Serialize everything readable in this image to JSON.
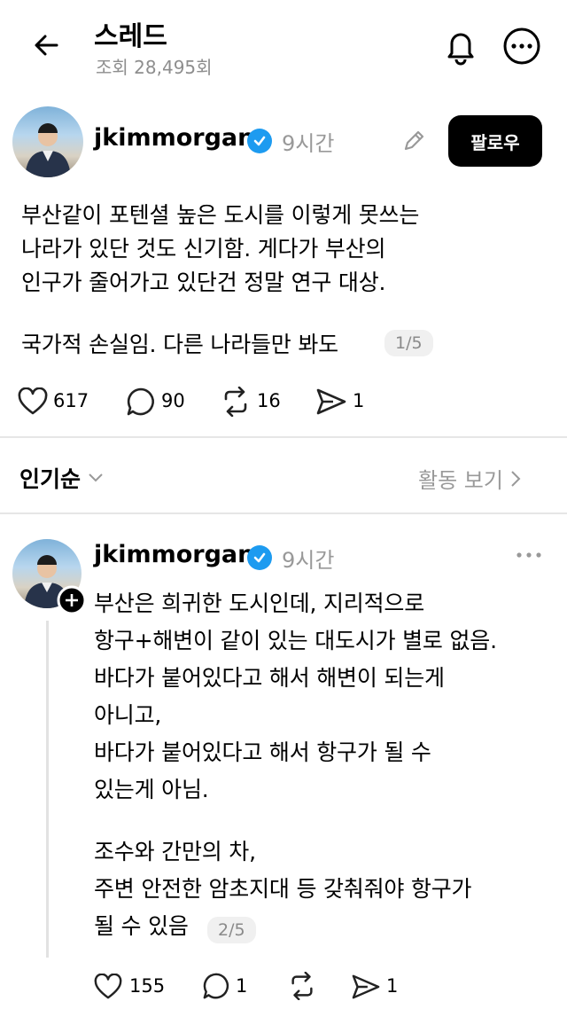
{
  "header": {
    "title": "스레드",
    "views": "조회 28,495회"
  },
  "post": {
    "username": "jkimmorgan",
    "time": "9시간",
    "follow_label": "팔로우",
    "text_lines": [
      "부산같이 포텐셜 높은 도시를 이렇게 못쓰는",
      "나라가 있단 것도 신기함. 게다가 부산의",
      "인구가 줄어가고 있단건 정말 연구 대상."
    ],
    "text_last": "국가적 손실임. 다른 나라들만 봐도",
    "pager": "1/5",
    "likes": "617",
    "comments": "90",
    "reposts": "16",
    "shares": "1"
  },
  "sort": {
    "label": "인기순",
    "activity_label": "활동 보기"
  },
  "reply": {
    "username": "jkimmorgan",
    "time": "9시간",
    "lines": [
      "부산은 희귀한 도시인데, 지리적으로",
      "항구+해변이 같이 있는 대도시가 별로 없음.",
      "바다가 붙어있다고 해서 해변이 되는게",
      "아니고,",
      "바다가 붙어있다고 해서 항구가 될 수",
      "있는게 아님."
    ],
    "lines2": [
      "조수와 간만의 차,",
      "주변 안전한 암초지대 등 갖춰줘야 항구가"
    ],
    "last_line": "될 수 있음",
    "pager": "2/5",
    "likes": "155",
    "comments": "1",
    "shares": "1"
  },
  "colors": {
    "verified": "#1d9bf0",
    "muted": "#999999",
    "follow_bg": "#000000"
  }
}
